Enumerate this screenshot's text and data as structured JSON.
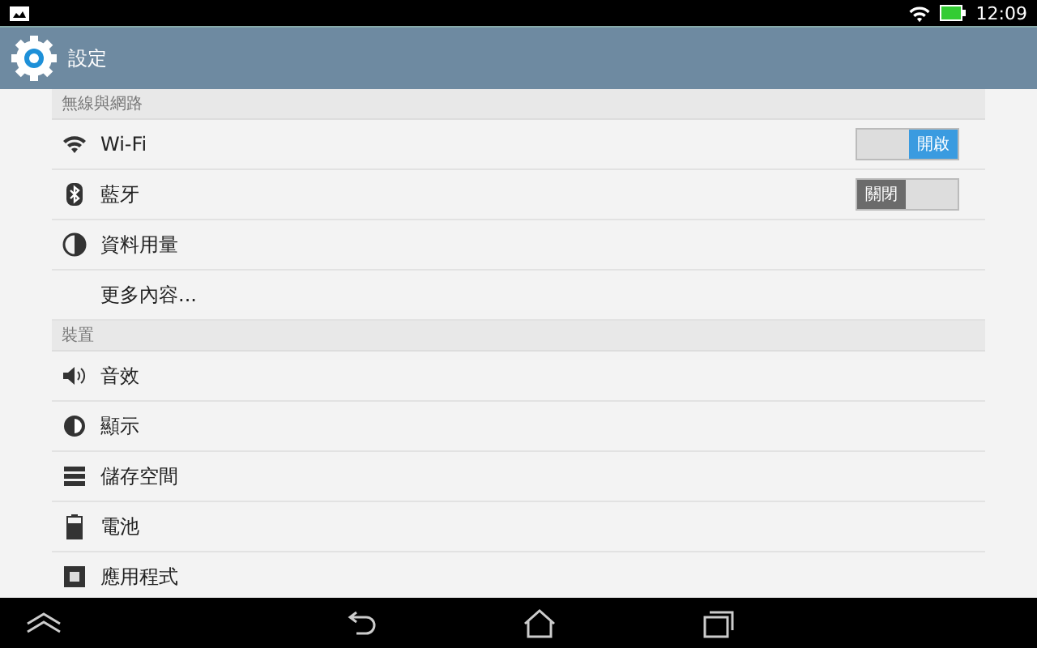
{
  "status_bar": {
    "time": "12:09"
  },
  "action_bar": {
    "title": "設定"
  },
  "sections": [
    {
      "header": "無線與網路",
      "items": [
        {
          "label": "Wi-Fi",
          "kind": "toggle",
          "on": true,
          "toggle_text": "開啟"
        },
        {
          "label": "藍牙",
          "kind": "toggle",
          "on": false,
          "toggle_text": "關閉"
        },
        {
          "label": "資料用量",
          "kind": "plain"
        },
        {
          "label": "更多內容...",
          "kind": "plain"
        }
      ]
    },
    {
      "header": "裝置",
      "items": [
        {
          "label": "音效",
          "kind": "plain"
        },
        {
          "label": "顯示",
          "kind": "plain"
        },
        {
          "label": "儲存空間",
          "kind": "plain"
        },
        {
          "label": "電池",
          "kind": "plain"
        },
        {
          "label": "應用程式",
          "kind": "plain"
        }
      ]
    }
  ]
}
